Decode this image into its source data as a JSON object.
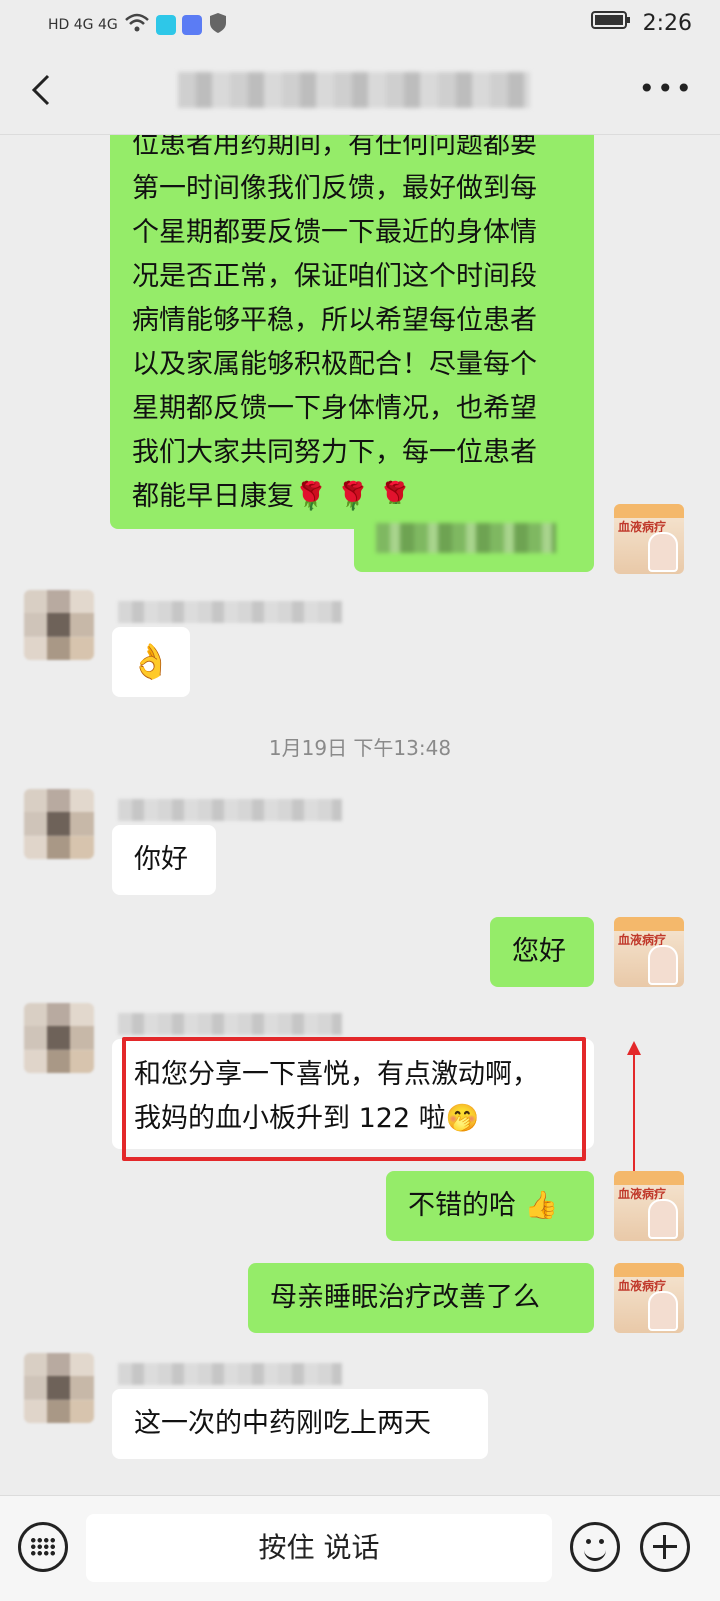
{
  "statusbar": {
    "left_text": "HD 4G 4G",
    "battery_icon": "battery-icon",
    "time": "2:26"
  },
  "header": {
    "back_icon": "chevron-left-icon",
    "more_icon": "more-dots-icon",
    "more_label": "•••"
  },
  "messages": {
    "m1_lines": [
      "位患者用药期间，有任何问题都要",
      "第一时间像我们反馈，最好做到每",
      "个星期都要反馈一下最近的身体情",
      "况是否正常，保证咱们这个时间段",
      "病情能够平稳，所以希望每位患者",
      "以及家属能够积极配合！尽量每个",
      "星期都反馈一下身体情况，也希望",
      "我们大家共同努力下，每一位患者",
      "都能早日康复🌹 🌹 🌹"
    ],
    "m3_text": "👌",
    "timestamp": "1月19日 下午13:48",
    "m4_text": "你好",
    "m5_text": "您好",
    "m6_line1": "和您分享一下喜悦，有点激动啊，",
    "m6_line2": "我妈的血小板升到 122 啦🤭",
    "m7_text": "不错的哈 👍",
    "m8_text": "母亲睡眠治疗改善了么",
    "m9_text": "这一次的中药刚吃上两天",
    "doctor_avatar_text": "血液病疗"
  },
  "bottombar": {
    "keyboard_icon": "keyboard-icon",
    "talk_label": "按住 说话",
    "emoji_icon": "smiley-icon",
    "plus_icon": "plus-icon"
  },
  "colors": {
    "sent_bubble": "#95ec69",
    "received_bubble": "#ffffff",
    "highlight": "#e3282a",
    "background": "#ededed"
  }
}
